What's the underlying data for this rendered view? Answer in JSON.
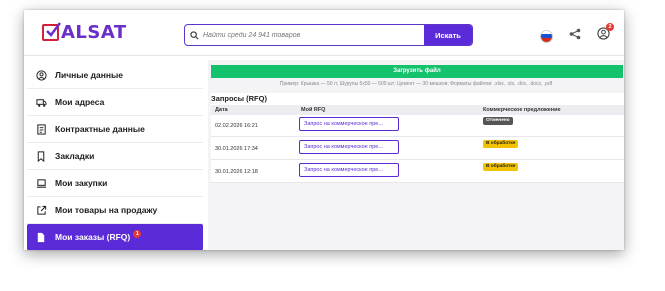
{
  "header": {
    "logo_text": "ALSAT",
    "search": {
      "placeholder": "Найти среди 24 941 товаров",
      "button_label": "Искать"
    },
    "notifications_count": "2"
  },
  "sidebar": {
    "items": [
      {
        "label": "Личные данные",
        "icon": "user-circle-icon"
      },
      {
        "label": "Мои адреса",
        "icon": "truck-icon"
      },
      {
        "label": "Контрактные данные",
        "icon": "contract-icon"
      },
      {
        "label": "Закладки",
        "icon": "bookmark-icon"
      },
      {
        "label": "Мои закупки",
        "icon": "cart-icon"
      },
      {
        "label": "Мои товары на продажу",
        "icon": "external-link-icon"
      },
      {
        "label": "Мои заказы (RFQ)",
        "icon": "document-icon",
        "badge": "1",
        "active": true
      }
    ]
  },
  "main": {
    "upload_label": "Загрузить файл",
    "hint": "Пример: Крышка — 50 л; Шурупы 5х50 — 500 шт; Цемент — 30 мешков; Форматы файлов: .xlsx, .xls, .doc, .docx, .pdf",
    "section_title": "Запросы (RFQ)",
    "columns": [
      "Дата",
      "Мой RFQ",
      "Коммерческое предложение"
    ],
    "rows": [
      {
        "date": "02.02.2026 16:21",
        "request": "Запрос на коммерческое пре...",
        "status": "Отменено"
      },
      {
        "date": "30.01.2026 17:34",
        "request": "Запрос на коммерческое пре...",
        "status": "В обработке"
      },
      {
        "date": "30.01.2026 12:18",
        "request": "Запрос на коммерческое пре...",
        "status": "В обработке"
      }
    ]
  },
  "colors": {
    "brand": "#5b2bd9",
    "upload": "#13c26b",
    "status_cancelled": "#555555",
    "status_processing": "#f2c200"
  }
}
